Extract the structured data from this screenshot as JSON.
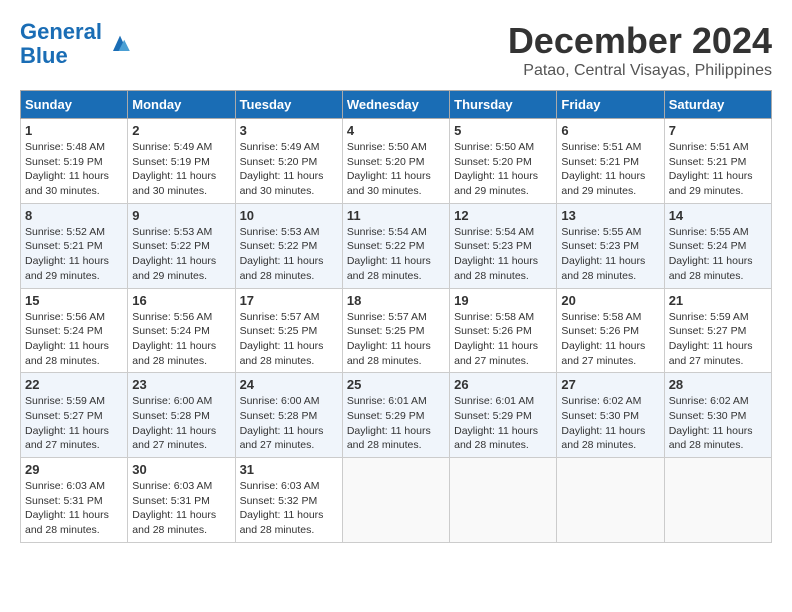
{
  "logo": {
    "line1": "General",
    "line2": "Blue"
  },
  "title": "December 2024",
  "subtitle": "Patao, Central Visayas, Philippines",
  "weekdays": [
    "Sunday",
    "Monday",
    "Tuesday",
    "Wednesday",
    "Thursday",
    "Friday",
    "Saturday"
  ],
  "weeks": [
    [
      {
        "day": "1",
        "sunrise": "5:48 AM",
        "sunset": "5:19 PM",
        "daylight": "11 hours and 30 minutes."
      },
      {
        "day": "2",
        "sunrise": "5:49 AM",
        "sunset": "5:19 PM",
        "daylight": "11 hours and 30 minutes."
      },
      {
        "day": "3",
        "sunrise": "5:49 AM",
        "sunset": "5:20 PM",
        "daylight": "11 hours and 30 minutes."
      },
      {
        "day": "4",
        "sunrise": "5:50 AM",
        "sunset": "5:20 PM",
        "daylight": "11 hours and 30 minutes."
      },
      {
        "day": "5",
        "sunrise": "5:50 AM",
        "sunset": "5:20 PM",
        "daylight": "11 hours and 29 minutes."
      },
      {
        "day": "6",
        "sunrise": "5:51 AM",
        "sunset": "5:21 PM",
        "daylight": "11 hours and 29 minutes."
      },
      {
        "day": "7",
        "sunrise": "5:51 AM",
        "sunset": "5:21 PM",
        "daylight": "11 hours and 29 minutes."
      }
    ],
    [
      {
        "day": "8",
        "sunrise": "5:52 AM",
        "sunset": "5:21 PM",
        "daylight": "11 hours and 29 minutes."
      },
      {
        "day": "9",
        "sunrise": "5:53 AM",
        "sunset": "5:22 PM",
        "daylight": "11 hours and 29 minutes."
      },
      {
        "day": "10",
        "sunrise": "5:53 AM",
        "sunset": "5:22 PM",
        "daylight": "11 hours and 28 minutes."
      },
      {
        "day": "11",
        "sunrise": "5:54 AM",
        "sunset": "5:22 PM",
        "daylight": "11 hours and 28 minutes."
      },
      {
        "day": "12",
        "sunrise": "5:54 AM",
        "sunset": "5:23 PM",
        "daylight": "11 hours and 28 minutes."
      },
      {
        "day": "13",
        "sunrise": "5:55 AM",
        "sunset": "5:23 PM",
        "daylight": "11 hours and 28 minutes."
      },
      {
        "day": "14",
        "sunrise": "5:55 AM",
        "sunset": "5:24 PM",
        "daylight": "11 hours and 28 minutes."
      }
    ],
    [
      {
        "day": "15",
        "sunrise": "5:56 AM",
        "sunset": "5:24 PM",
        "daylight": "11 hours and 28 minutes."
      },
      {
        "day": "16",
        "sunrise": "5:56 AM",
        "sunset": "5:24 PM",
        "daylight": "11 hours and 28 minutes."
      },
      {
        "day": "17",
        "sunrise": "5:57 AM",
        "sunset": "5:25 PM",
        "daylight": "11 hours and 28 minutes."
      },
      {
        "day": "18",
        "sunrise": "5:57 AM",
        "sunset": "5:25 PM",
        "daylight": "11 hours and 28 minutes."
      },
      {
        "day": "19",
        "sunrise": "5:58 AM",
        "sunset": "5:26 PM",
        "daylight": "11 hours and 27 minutes."
      },
      {
        "day": "20",
        "sunrise": "5:58 AM",
        "sunset": "5:26 PM",
        "daylight": "11 hours and 27 minutes."
      },
      {
        "day": "21",
        "sunrise": "5:59 AM",
        "sunset": "5:27 PM",
        "daylight": "11 hours and 27 minutes."
      }
    ],
    [
      {
        "day": "22",
        "sunrise": "5:59 AM",
        "sunset": "5:27 PM",
        "daylight": "11 hours and 27 minutes."
      },
      {
        "day": "23",
        "sunrise": "6:00 AM",
        "sunset": "5:28 PM",
        "daylight": "11 hours and 27 minutes."
      },
      {
        "day": "24",
        "sunrise": "6:00 AM",
        "sunset": "5:28 PM",
        "daylight": "11 hours and 27 minutes."
      },
      {
        "day": "25",
        "sunrise": "6:01 AM",
        "sunset": "5:29 PM",
        "daylight": "11 hours and 28 minutes."
      },
      {
        "day": "26",
        "sunrise": "6:01 AM",
        "sunset": "5:29 PM",
        "daylight": "11 hours and 28 minutes."
      },
      {
        "day": "27",
        "sunrise": "6:02 AM",
        "sunset": "5:30 PM",
        "daylight": "11 hours and 28 minutes."
      },
      {
        "day": "28",
        "sunrise": "6:02 AM",
        "sunset": "5:30 PM",
        "daylight": "11 hours and 28 minutes."
      }
    ],
    [
      {
        "day": "29",
        "sunrise": "6:03 AM",
        "sunset": "5:31 PM",
        "daylight": "11 hours and 28 minutes."
      },
      {
        "day": "30",
        "sunrise": "6:03 AM",
        "sunset": "5:31 PM",
        "daylight": "11 hours and 28 minutes."
      },
      {
        "day": "31",
        "sunrise": "6:03 AM",
        "sunset": "5:32 PM",
        "daylight": "11 hours and 28 minutes."
      },
      null,
      null,
      null,
      null
    ]
  ]
}
